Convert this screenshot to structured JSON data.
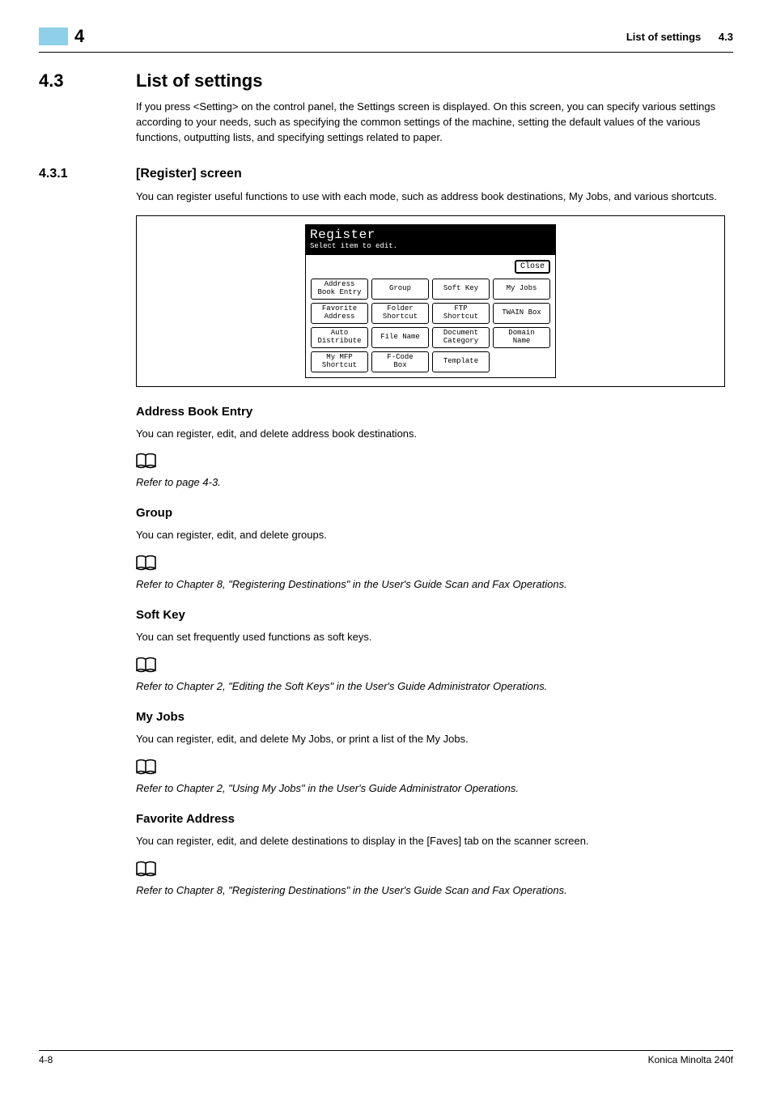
{
  "header": {
    "chapter_number": "4",
    "breadcrumb_title": "List of settings",
    "breadcrumb_section": "4.3"
  },
  "section": {
    "number": "4.3",
    "title": "List of settings",
    "intro": "If you press <Setting> on the control panel, the Settings screen is displayed. On this screen, you can specify various settings according to your needs, such as specifying the common settings of the machine, setting the default values of the various functions, outputting lists, and specifying settings related to paper."
  },
  "subsection": {
    "number": "4.3.1",
    "title": "[Register] screen",
    "intro": "You can register useful functions to use with each mode, such as address book destinations, My Jobs, and various shortcuts."
  },
  "screenshot": {
    "title": "Register",
    "subtitle": "Select item to edit.",
    "close": "Close",
    "grid": [
      [
        "Address\nBook Entry",
        "Group",
        "Soft Key",
        "My Jobs"
      ],
      [
        "Favorite\nAddress",
        "Folder\nShortcut",
        "FTP\nShortcut",
        "TWAIN Box"
      ],
      [
        "Auto\nDistribute",
        "File Name",
        "Document\nCategory",
        "Domain\nName"
      ],
      [
        "My MFP\nShortcut",
        "F-Code\nBox",
        "Template",
        ""
      ]
    ]
  },
  "items": {
    "address_book": {
      "heading": "Address Book Entry",
      "text": "You can register, edit, and delete address book destinations.",
      "refer": "Refer to page 4-3."
    },
    "group": {
      "heading": "Group",
      "text": "You can register, edit, and delete groups.",
      "refer": "Refer to Chapter 8, \"Registering Destinations\" in the User's Guide Scan and Fax Operations."
    },
    "soft_key": {
      "heading": "Soft Key",
      "text": "You can set frequently used functions as soft keys.",
      "refer": "Refer to Chapter 2, \"Editing the Soft Keys\" in the User's Guide Administrator Operations."
    },
    "my_jobs": {
      "heading": "My Jobs",
      "text": "You can register, edit, and delete My Jobs, or print a list of the My Jobs.",
      "refer": "Refer to Chapter 2, \"Using My Jobs\" in the User's Guide Administrator Operations."
    },
    "favorite_address": {
      "heading": "Favorite Address",
      "text": "You can register, edit, and delete destinations to display in the [Faves] tab on the scanner screen.",
      "refer": "Refer to Chapter 8, \"Registering Destinations\" in the User's Guide Scan and Fax Operations."
    }
  },
  "footer": {
    "page": "4-8",
    "product": "Konica Minolta 240f"
  }
}
